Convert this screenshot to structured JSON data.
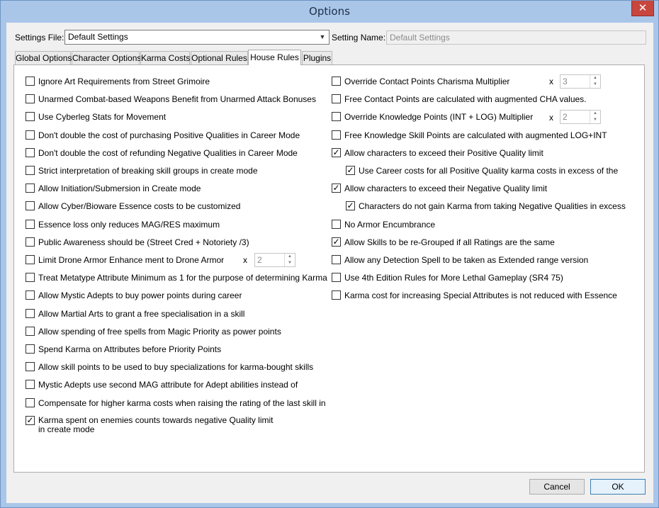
{
  "window": {
    "title": "Options",
    "close_glyph": "✕"
  },
  "header": {
    "settings_file_label": "Settings File:",
    "settings_file_value": "Default Settings",
    "setting_name_label": "Setting Name:",
    "setting_name_value": "Default Settings"
  },
  "tabs": [
    {
      "label": "Global Options"
    },
    {
      "label": "Character Options"
    },
    {
      "label": "Karma Costs"
    },
    {
      "label": "Optional Rules"
    },
    {
      "label": "House Rules",
      "active": true
    },
    {
      "label": "Plugins"
    }
  ],
  "left_options": [
    {
      "label": "Ignore Art Requirements from Street Grimoire",
      "checked": false
    },
    {
      "label": "Unarmed Combat-based Weapons Benefit from Unarmed Attack Bonuses",
      "checked": false
    },
    {
      "label": "Use Cyberleg Stats for Movement",
      "checked": false
    },
    {
      "label": "Don't double the cost of purchasing Positive Qualities in Career Mode",
      "checked": false
    },
    {
      "label": "Don't double the cost of refunding Negative Qualities in Career Mode",
      "checked": false
    },
    {
      "label": "Strict interpretation of breaking skill groups in create mode",
      "checked": false
    },
    {
      "label": "Allow Initiation/Submersion in Create mode",
      "checked": false
    },
    {
      "label": "Allow Cyber/Bioware Essence costs to be customized",
      "checked": false
    },
    {
      "label": "Essence loss only reduces MAG/RES maximum",
      "checked": false
    },
    {
      "label": "Public Awareness should be (Street Cred + Notoriety /3)",
      "checked": false
    },
    {
      "label": "Limit Drone Armor Enhance ment to Drone Armor",
      "checked": false
    },
    {
      "label": "Treat Metatype Attribute Minimum as 1 for the purpose of determining Karma",
      "checked": false
    },
    {
      "label": "Allow Mystic Adepts to buy power points during career",
      "checked": false
    },
    {
      "label": "Allow Martial Arts to grant a free specialisation in a skill",
      "checked": false
    },
    {
      "label": "Allow spending of free spells from Magic Priority as power points",
      "checked": false
    },
    {
      "label": "Spend Karma on Attributes before Priority Points",
      "checked": false
    },
    {
      "label": "Allow skill points to be used to buy specializations for karma-bought skills",
      "checked": false
    },
    {
      "label": "Mystic Adepts use second MAG attribute for Adept abilities instead of",
      "checked": false
    },
    {
      "label": "Compensate for higher karma costs when raising the rating of the last skill in",
      "checked": false
    },
    {
      "label": "Karma spent on enemies counts towards negative Quality limit in create mode",
      "checked": true
    }
  ],
  "right_options": [
    {
      "label": "Override Contact Points Charisma Multiplier",
      "checked": false
    },
    {
      "label": "Free Contact Points are calculated with augmented CHA values.",
      "checked": false
    },
    {
      "label": "Override Knowledge Points (INT + LOG) Multiplier",
      "checked": false
    },
    {
      "label": "Free Knowledge Skill Points are calculated with augmented LOG+INT",
      "checked": false
    },
    {
      "label": "Allow characters to exceed their Positive Quality limit",
      "checked": true
    },
    {
      "label": "Use Career costs for all Positive Quality karma costs in excess of the",
      "checked": true
    },
    {
      "label": "Allow characters to exceed their Negative Quality limit",
      "checked": true
    },
    {
      "label": "Characters do not gain Karma from taking Negative Qualities in excess",
      "checked": true
    },
    {
      "label": "No Armor Encumbrance",
      "checked": false
    },
    {
      "label": "Allow Skills to be re-Grouped if all Ratings are the same",
      "checked": true
    },
    {
      "label": "Allow any Detection Spell to be taken as Extended range version",
      "checked": false
    },
    {
      "label": "Use 4th Edition Rules for More Lethal Gameplay (SR4 75)",
      "checked": false
    },
    {
      "label": "Karma cost for increasing Special Attributes is not reduced with Essence",
      "checked": false
    }
  ],
  "multipliers": {
    "x_label": "x",
    "contact_points": "3",
    "knowledge_points": "2",
    "drone_armor": "2"
  },
  "footer": {
    "cancel_label": "Cancel",
    "ok_label": "OK"
  }
}
